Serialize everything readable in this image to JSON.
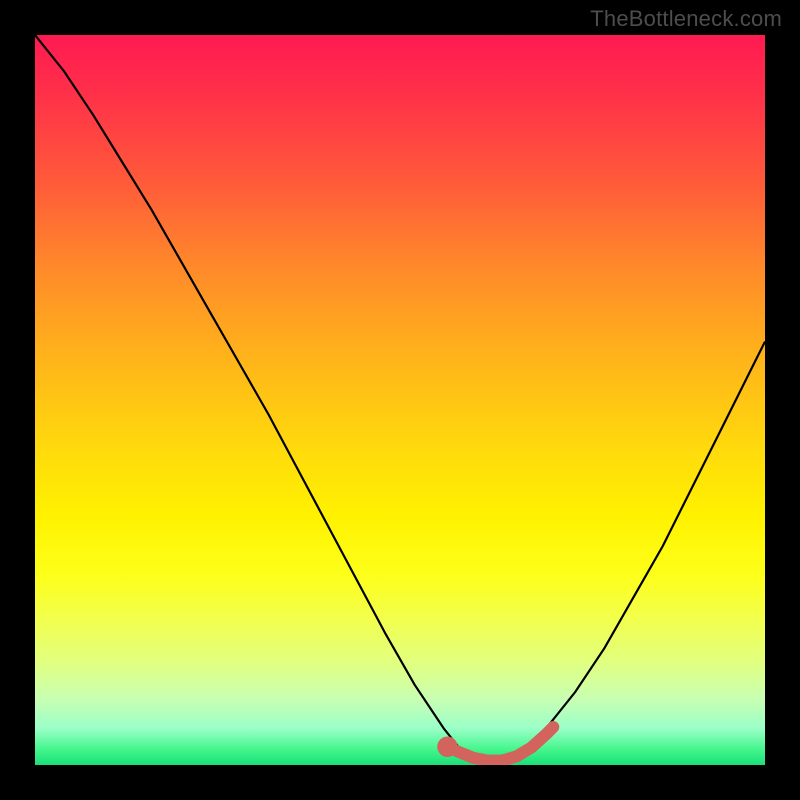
{
  "watermark": {
    "text": "TheBottleneck.com"
  },
  "colors": {
    "curve": "#000000",
    "highlight": "#d2635d",
    "gradient_top": "#ff1a52",
    "gradient_bottom": "#1adf7a",
    "background": "#000000"
  },
  "chart_data": {
    "type": "line",
    "title": "",
    "xlabel": "",
    "ylabel": "",
    "xlim": [
      0,
      100
    ],
    "ylim": [
      0,
      100
    ],
    "axes_visible": false,
    "grid": false,
    "series": [
      {
        "name": "bottleneck-curve",
        "x": [
          0,
          4,
          8,
          12,
          16,
          20,
          24,
          28,
          32,
          36,
          40,
          44,
          48,
          52,
          56,
          58,
          60,
          62,
          64,
          66,
          70,
          74,
          78,
          82,
          86,
          90,
          94,
          98,
          100
        ],
        "y": [
          100,
          95,
          89,
          82.5,
          76,
          69,
          62,
          55,
          48,
          40.5,
          33,
          25.5,
          18,
          11,
          5,
          2.5,
          1,
          0.5,
          0.5,
          1.5,
          5,
          10,
          16,
          23,
          30,
          38,
          46,
          54,
          58
        ],
        "color": "#000000"
      },
      {
        "name": "highlight-segment",
        "x": [
          56.5,
          58,
          60,
          62,
          64,
          66,
          68,
          70,
          71
        ],
        "y": [
          2.5,
          1.8,
          1,
          0.6,
          0.6,
          1.2,
          2.4,
          4.2,
          5.2
        ],
        "color": "#d2635d"
      }
    ],
    "markers": [
      {
        "name": "highlight-start-dot",
        "x": 56.5,
        "y": 2.5,
        "r": 1.4,
        "color": "#d2635d"
      }
    ]
  }
}
